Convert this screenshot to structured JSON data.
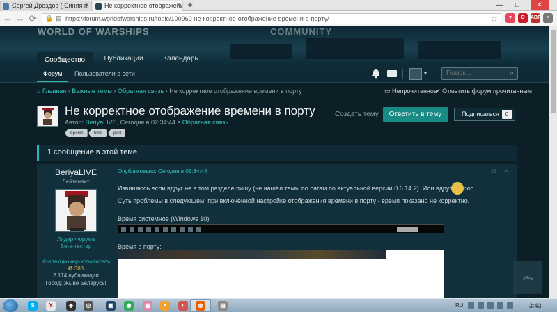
{
  "browser": {
    "tabs": [
      {
        "title": "Сергей Дроздов ( Синяя п"
      },
      {
        "title": "Не корректное отображени"
      }
    ],
    "new_tab": "+",
    "address": "https://forum.worldofwarships.ru/topic/100960-не-корректное-отображение-времени-в-порту/",
    "controls": {
      "minimize": "—",
      "maximize": "□",
      "close": "✕"
    },
    "extensions": [
      "Pocket",
      "Opera",
      "ABP",
      "Menu"
    ],
    "ext_labels": {
      "abp": "ABP"
    },
    "colors": {
      "tabbar": "#e6e6e6",
      "toolbar": "#f4f4f4",
      "close": "#e04343"
    }
  },
  "site": {
    "logo_text": "WORLD OF WARSHIPS",
    "banner_text": "COMMUNITY",
    "main_tabs": [
      {
        "label": "Сообщество",
        "active": true
      },
      {
        "label": "Публикации",
        "active": false
      },
      {
        "label": "Календарь",
        "active": false
      }
    ],
    "sub_nav": [
      {
        "label": "Форум",
        "active": true
      },
      {
        "label": "Пользователи в сети",
        "active": false
      }
    ],
    "search_placeholder": "Поиск...",
    "accent": "#2bb7b0"
  },
  "breadcrumb": {
    "home": "Главная",
    "items": [
      "Важные темы",
      "Обратная связь"
    ],
    "current": "Не корректное отображение времени в порту",
    "separator": "›"
  },
  "actions": {
    "unread": "Непрочитанное",
    "mark_read": "Отметить форум прочитанным"
  },
  "topic": {
    "title": "Не корректное отображение времени в порту",
    "meta_prefix": "Автор:",
    "author": "BeriyaLIVE",
    "meta_mid": ", Сегодня в 02:34:44 в",
    "forum": "Обратная связь",
    "tags": [
      "время",
      "time",
      "port"
    ],
    "create_topic": "Создать тему",
    "reply": "Ответить в тему",
    "follow": "Подписаться",
    "follow_count": "0",
    "post_count_text": "1 сообщение в этой теме"
  },
  "post": {
    "author": {
      "name": "BeriyaLIVE",
      "rank": "Лейтенант",
      "groups": [
        "Лидер Форума",
        "Бета-тестер"
      ],
      "collector_title": "Коллекционер-испытатель",
      "reputation": "388",
      "posts": "2 174 публикации",
      "city": "Город: Жыве Беларусь!"
    },
    "posted": "Опубликовано: Сегодня в 02:34:44",
    "number": "#1",
    "paragraphs": [
      "Извиняюсь если вдруг не в том разделе пишу (не нашёл темы по багам по актуальной версии 0.6.14.2). Или вдруг вопрос",
      "Суть проблемы в следующем: при включённой настройке отображения времени в порту - время показано не корректно."
    ],
    "caption_system": "Время системное (Windows 10):",
    "caption_port": "Время в порту:"
  },
  "windows": {
    "lang": "RU",
    "clock": "3:43"
  }
}
